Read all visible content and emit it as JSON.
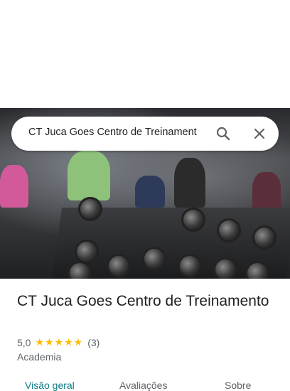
{
  "search": {
    "query": "CT Juca Goes Centro de Treinament"
  },
  "place": {
    "name": "CT Juca Goes Centro de Treinamento",
    "rating": "5,0",
    "stars": "★★★★★",
    "review_count": "(3)",
    "category": "Academia"
  },
  "tabs": [
    {
      "label": "Visão geral",
      "active": true
    },
    {
      "label": "Avaliações",
      "active": false
    },
    {
      "label": "Sobre",
      "active": false
    }
  ],
  "icons": {
    "search": "search-icon",
    "close": "close-icon"
  },
  "colors": {
    "accent": "#0b7b84",
    "star": "#fbbc04",
    "text": "#202124",
    "secondary": "#5f6368"
  }
}
